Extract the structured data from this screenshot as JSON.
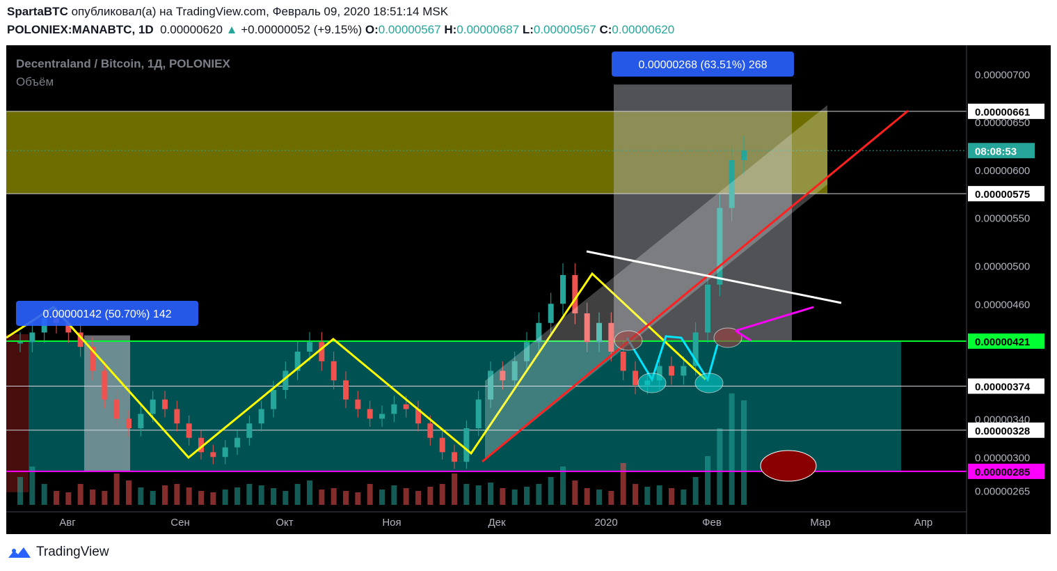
{
  "header": {
    "author": "SpartaBTC",
    "published_text": "опубликовал(а) на TradingView.com, Февраль 09, 2020 18:51:14 MSK",
    "symbol": "POLONIEX:MANABTC, 1D",
    "last_price": "0.00000620",
    "change_arrow": "▲",
    "change": "+0.00000052 (+9.15%)",
    "o_label": "O:",
    "o_value": "0.00000567",
    "h_label": "H:",
    "h_value": "0.00000687",
    "l_label": "L:",
    "l_value": "0.00000567",
    "c_label": "C:",
    "c_value": "0.00000620"
  },
  "legend": {
    "pair": "Decentraland / Bitcoin, 1Д, POLONIEX",
    "volume": "Объём"
  },
  "footer": {
    "brand": "TradingView"
  },
  "colors": {
    "up": "#26a69a",
    "down": "#ef5350",
    "pattern": "#ffff00",
    "support": "#00ff33",
    "magenta": "#ff00ff",
    "zone": "#7a7a00",
    "range": "#006060"
  },
  "chart_data": {
    "type": "candlestick",
    "title": "Decentraland / Bitcoin, 1Д, POLONIEX",
    "x_ticks": [
      "Авг",
      "Сен",
      "Окт",
      "Ноя",
      "Дек",
      "2020",
      "Фев",
      "Мар",
      "Апр"
    ],
    "y_ticks": [
      "0.00000700",
      "0.00000650",
      "0.00000600",
      "0.00000550",
      "0.00000500",
      "0.00000460",
      "0.00000340",
      "0.00000300",
      "0.00000265"
    ],
    "ylim": [
      2.5e-06,
      7.3e-06
    ],
    "price_labels": [
      {
        "text": "0.00000661",
        "value": 6.61e-06,
        "style": "white"
      },
      {
        "text": "08:08:53",
        "value": 6.2e-06,
        "style": "teal"
      },
      {
        "text": "0.00000575",
        "value": 5.75e-06,
        "style": "white"
      },
      {
        "text": "0.00000421",
        "value": 4.21e-06,
        "style": "green"
      },
      {
        "text": "0.00000374",
        "value": 3.74e-06,
        "style": "white"
      },
      {
        "text": "0.00000328",
        "value": 3.28e-06,
        "style": "white"
      },
      {
        "text": "0.00000285",
        "value": 2.85e-06,
        "style": "magenta"
      }
    ],
    "measure_boxes": [
      {
        "text": "0.00000142 (50.70%) 142",
        "value_from": 2.85e-06,
        "value_to": 4.27e-06
      },
      {
        "text": "0.00000268 (63.51%) 268",
        "value_from": 4.21e-06,
        "value_to": 6.89e-06
      }
    ],
    "resistance_zone": [
      5.75e-06,
      6.61e-06
    ],
    "range_zone": [
      2.85e-06,
      4.21e-06
    ],
    "series": [
      {
        "name": "MANABTC",
        "values": [
          4.2e-06,
          4.3e-06,
          4.45e-06,
          4.4e-06,
          4.3e-06,
          4.15e-06,
          3.9e-06,
          3.6e-06,
          3.4e-06,
          3.3e-06,
          3.45e-06,
          3.6e-06,
          3.5e-06,
          3.35e-06,
          3.2e-06,
          3.05e-06,
          3e-06,
          3.1e-06,
          3.2e-06,
          3.35e-06,
          3.5e-06,
          3.7e-06,
          3.9e-06,
          4.1e-06,
          4.2e-06,
          4e-06,
          3.8e-06,
          3.6e-06,
          3.5e-06,
          3.4e-06,
          3.45e-06,
          3.55e-06,
          3.5e-06,
          3.35e-06,
          3.2e-06,
          3.05e-06,
          2.95e-06,
          3.3e-06,
          3.6e-06,
          3.9e-06,
          3.8e-06,
          4e-06,
          4.2e-06,
          4.4e-06,
          4.6e-06,
          4.9e-06,
          4.5e-06,
          4.2e-06,
          4.4e-06,
          4.1e-06,
          3.9e-06,
          3.75e-06,
          3.8e-06,
          3.95e-06,
          3.85e-06,
          3.95e-06,
          4.3e-06,
          4.8e-06,
          5.6e-06,
          6.1e-06,
          6.2e-06
        ]
      }
    ]
  }
}
